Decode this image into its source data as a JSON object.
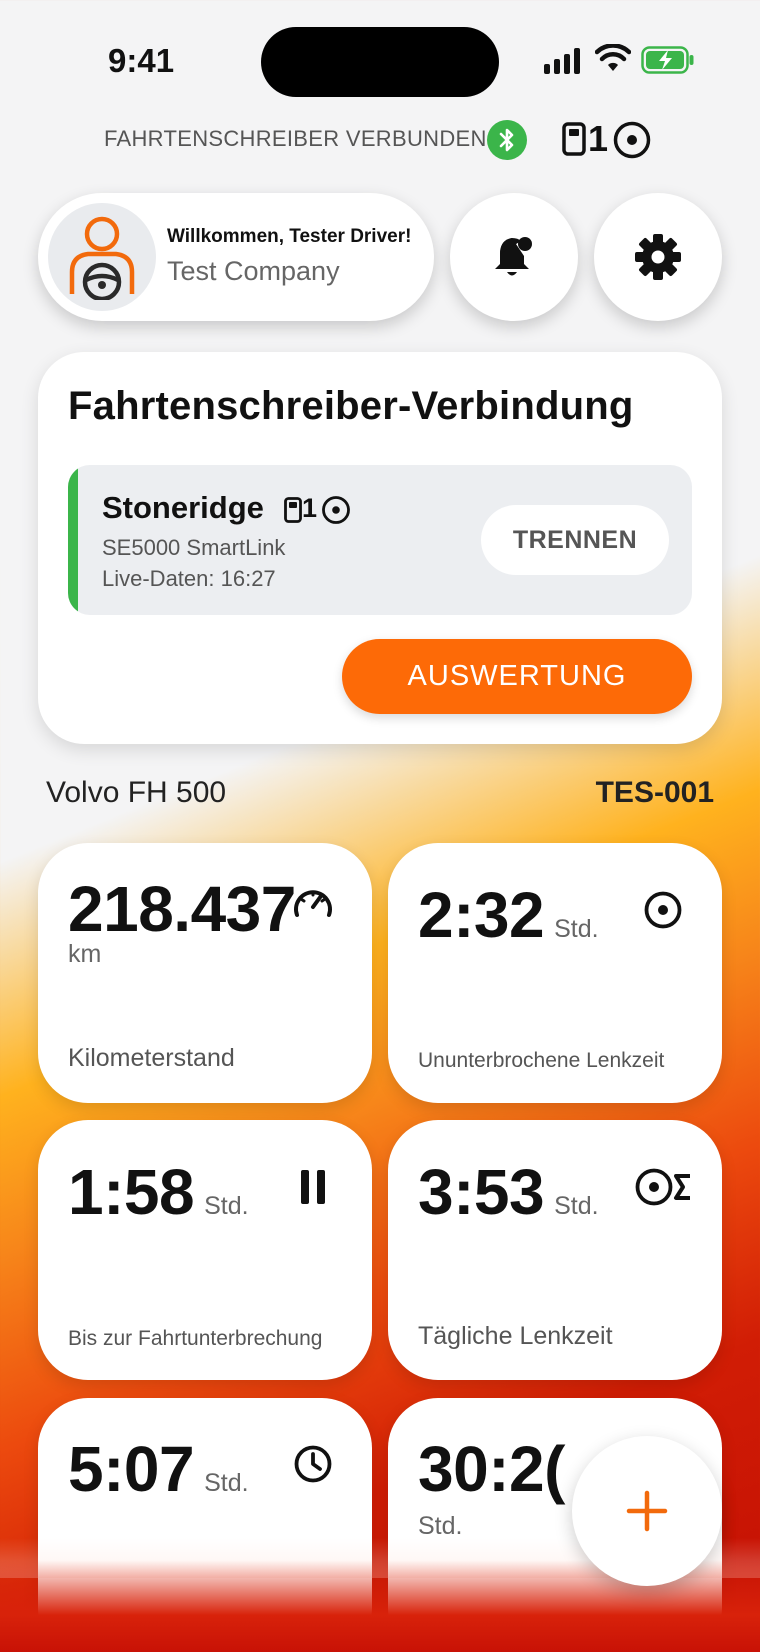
{
  "status_bar": {
    "time": "9:41"
  },
  "connection": {
    "status_text": "FAHRTENSCHREIBER VERBUNDEN",
    "slot_number": "1"
  },
  "profile": {
    "welcome": "Willkommen, Tester Driver!",
    "company": "Test Company"
  },
  "tachograph_card": {
    "title": "Fahrtenschreiber-Verbindung",
    "device_name": "Stoneridge",
    "slot_number": "1",
    "model": "SE5000 SmartLink",
    "live_data": "Live-Daten: 16:27",
    "disconnect_label": "TRENNEN",
    "evaluate_label": "AUSWERTUNG",
    "status_color": "#3bb54a"
  },
  "vehicle": {
    "model": "Volvo FH 500",
    "plate": "TES-001"
  },
  "tiles": [
    {
      "value": "218.437",
      "unit": "km",
      "label": "Kilometerstand",
      "icon": "speedometer-icon"
    },
    {
      "value": "2:32",
      "unit": "Std.",
      "label": "Ununterbrochene Lenkzeit",
      "icon": "steering-wheel-icon"
    },
    {
      "value": "1:58",
      "unit": "Std.",
      "label": "Bis zur Fahrtunterbrechung",
      "icon": "pause-icon"
    },
    {
      "value": "3:53",
      "unit": "Std.",
      "label": "Tägliche Lenkzeit",
      "icon": "steering-wheel-sum-icon"
    },
    {
      "value": "5:07",
      "unit": "Std.",
      "label": "",
      "icon": "clock-icon"
    },
    {
      "value": "30:2(",
      "unit": "Std.",
      "label": "",
      "icon": ""
    }
  ],
  "fab": {
    "icon": "plus-icon"
  },
  "colors": {
    "accent": "#fd6a07",
    "bluetooth": "#3bb54a"
  }
}
